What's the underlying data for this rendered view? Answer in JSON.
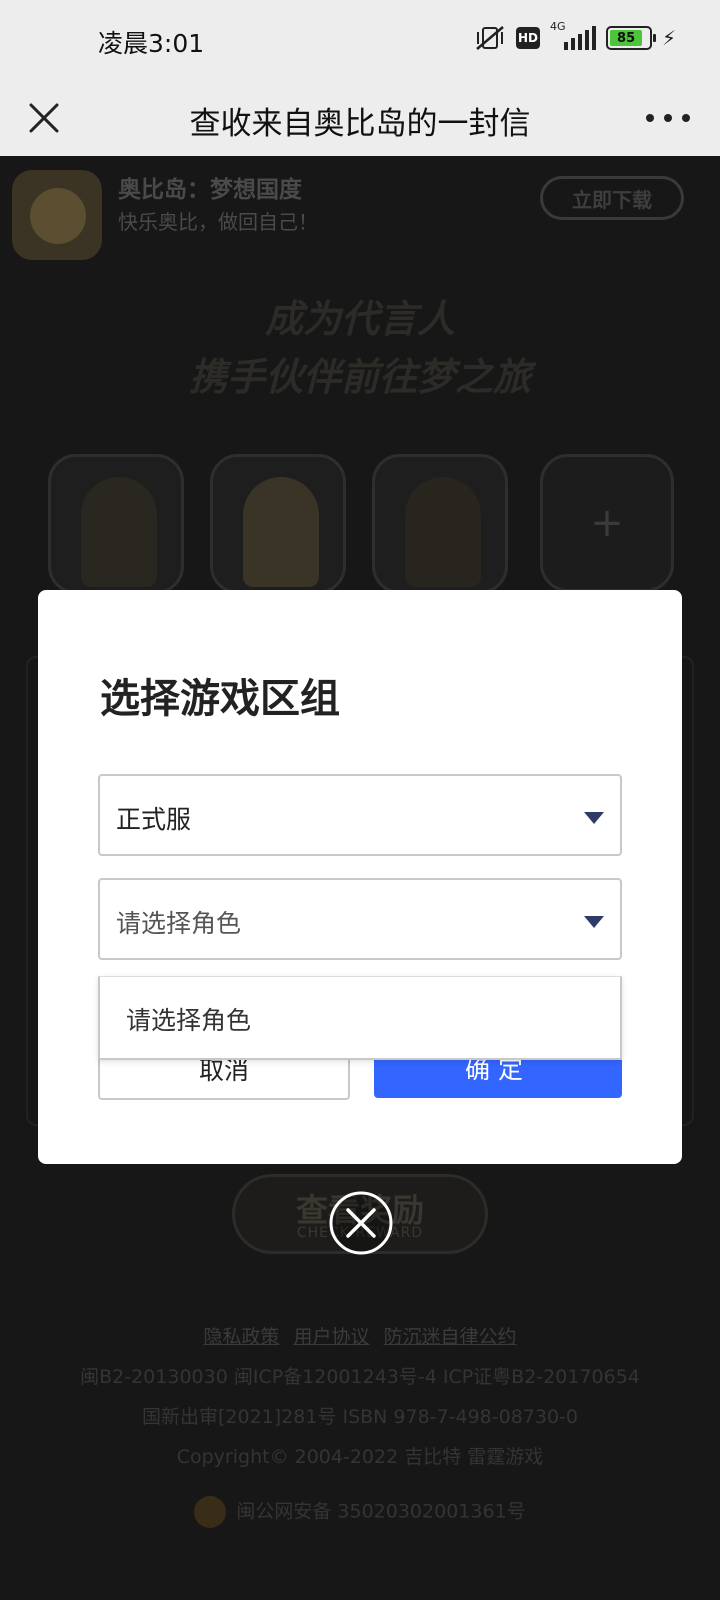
{
  "status_bar": {
    "time": "凌晨3:01",
    "network": "4G",
    "hd": "HD",
    "battery": "85"
  },
  "titlebar": {
    "title": "查收来自奥比岛的一封信",
    "close_icon": "close-icon",
    "more_icon": "more-icon"
  },
  "banner": {
    "app_name": "奥比岛：梦想国度",
    "slogan": "快乐奥比，做回自己！",
    "download": "立即下载"
  },
  "hero": {
    "line1": "成为代言人",
    "line2": "携手伙伴前往梦之旅",
    "add_symbol": "+"
  },
  "dialog": {
    "title": "选择游戏区组",
    "server_select": {
      "value": "正式服"
    },
    "role_select": {
      "placeholder": "请选择角色"
    },
    "dropdown_options": [
      "请选择角色"
    ],
    "cancel": "取消",
    "confirm": "确定"
  },
  "check_button": {
    "cn": "查看奖励",
    "en": "CHECK REWARD"
  },
  "footer": {
    "links": [
      "隐私政策",
      "用户协议",
      "防沉迷自律公约"
    ],
    "line1": "闽B2-20130030  闽ICP备12001243号-4  ICP证粤B2-20170654",
    "line2": "国新出审[2021]281号  ISBN 978-7-498-08730-0",
    "line3": "Copyright© 2004-2022  吉比特  雷霆游戏",
    "police": "闽公网安备 35020302001361号"
  },
  "colors": {
    "accent": "#3366ff",
    "caret": "#2d3b66",
    "overlay": "#171717"
  }
}
